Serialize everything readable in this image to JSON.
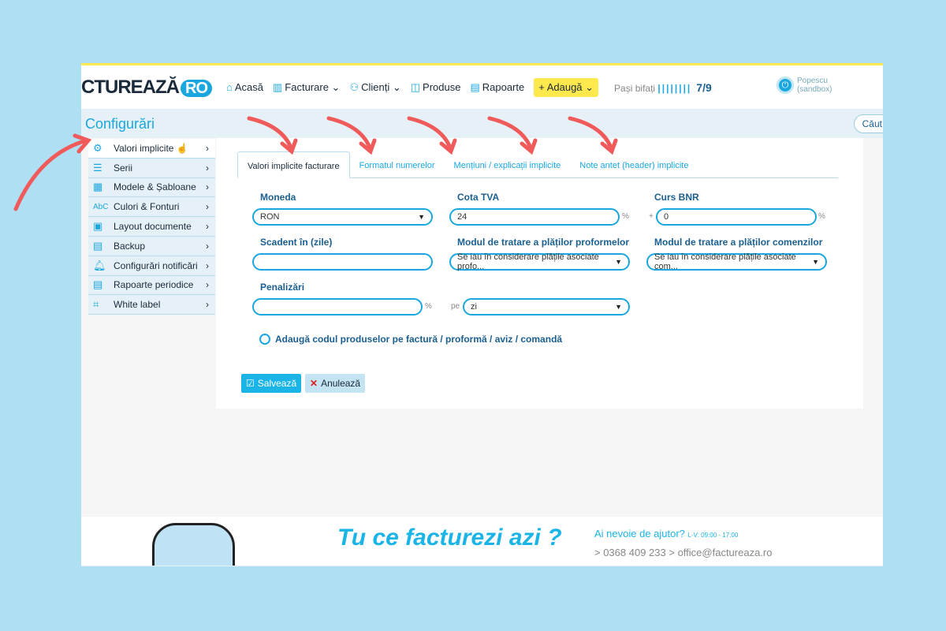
{
  "header": {
    "logo": "CTUREAZĂ",
    "logo_suffix": "RO",
    "nav": [
      {
        "label": "Acasă",
        "icon": "home-icon"
      },
      {
        "label": "Facturare ⌄",
        "icon": "invoice-icon"
      },
      {
        "label": "Clienți ⌄",
        "icon": "users-icon"
      },
      {
        "label": "Produse",
        "icon": "box-icon"
      },
      {
        "label": "Rapoarte",
        "icon": "clipboard-icon"
      }
    ],
    "add_label": "+ Adaugă ⌄",
    "steps_label": "Pași bifați",
    "steps_bars": "||||||||",
    "steps_value": "7/9",
    "user_name": "Popescu",
    "user_sub": "(sandbox)"
  },
  "page_title": "Configurări",
  "search_label": "Căut",
  "sidebar": {
    "items": [
      {
        "label": "Valori implicite",
        "active": true
      },
      {
        "label": "Serii"
      },
      {
        "label": "Modele & Șabloane"
      },
      {
        "label": "Culori & Fonturi"
      },
      {
        "label": "Layout documente"
      },
      {
        "label": "Backup"
      },
      {
        "label": "Configurări notificări"
      },
      {
        "label": "Rapoarte periodice"
      },
      {
        "label": "White label"
      }
    ]
  },
  "tabs": [
    "Valori implicite facturare",
    "Formatul numerelor",
    "Mențiuni / explicații implicite",
    "Note antet (header) implicite"
  ],
  "form": {
    "moneda_label": "Moneda",
    "moneda_value": "RON",
    "tva_label": "Cota TVA",
    "tva_value": "24",
    "bnr_label": "Curs BNR",
    "bnr_prefix": "+",
    "bnr_value": "0",
    "percent": "%",
    "scadent_label": "Scadent în (zile)",
    "scadent_value": "",
    "proforme_label": "Modul de tratare a plăților proformelor",
    "proforme_value": "Se iau în considerare plățile asociate profo...",
    "comenzi_label": "Modul de tratare a plăților comenzilor",
    "comenzi_value": "Se iau în considerare plățile asociate com...",
    "penalizari_label": "Penalizări",
    "penalizari_value": "",
    "pe_label": "pe",
    "pe_value": "zi",
    "checkbox_label": "Adaugă codul produselor pe factură / proformă / aviz / comandă",
    "checkbox_checked": false
  },
  "buttons": {
    "save": "Salvează",
    "cancel": "Anulează"
  },
  "footer": {
    "slogan": "Tu ce facturezi azi ?",
    "help": "Ai nevoie de ajutor?",
    "hours": "L-V: 09:00 - 17:00",
    "phone": "> 0368 409 233",
    "email": "> office@factureaza.ro"
  },
  "colors": {
    "accent": "#1aa7e0",
    "yellow": "#ffe94d",
    "arrow": "#f05a5a",
    "background": "#aedff2"
  }
}
